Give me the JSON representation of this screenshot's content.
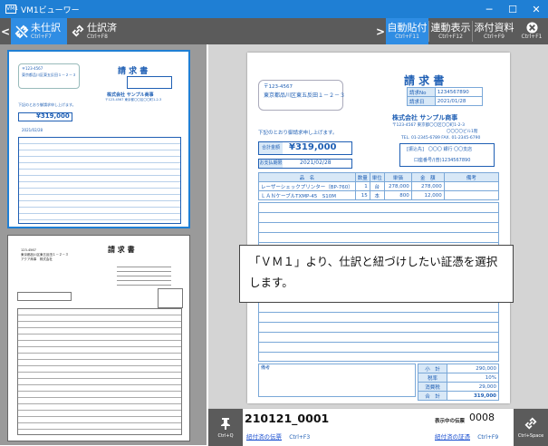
{
  "window": {
    "title": "VM1ビューワー",
    "icon_text": "VM1",
    "min": "─",
    "max": "☐",
    "close": "✕"
  },
  "toolbar": {
    "prev": "<",
    "next": ">",
    "unjournaled": {
      "label": "未仕訳",
      "shortcut": "Ctrl+F7"
    },
    "journaled": {
      "label": "仕訳済",
      "shortcut": "Ctrl+F8"
    },
    "auto_attach": {
      "label": "自動貼付",
      "shortcut": "Ctrl+F11"
    },
    "linked_view": {
      "label": "連動表示",
      "shortcut": "Ctrl+F12"
    },
    "attachments": {
      "label": "添付資料",
      "shortcut": "Ctrl+F9"
    },
    "close": {
      "shortcut": "Ctrl+F1"
    }
  },
  "invoice": {
    "postal": "〒123-4567",
    "address": "東京都品川区東五反田１－２－３",
    "title": "請 求 書",
    "no_label": "請求No",
    "no_value": "1234567890",
    "date_label": "請求日",
    "date_value": "2021/01/28",
    "company": "株式会社 サンプル商事",
    "company_addr": "〒123-4567 東京都〇〇区〇〇町1-2-3",
    "bldg": "〇〇〇〇ビル1階",
    "tel": "TEL. 01-2345-6789 FAX. 01-2345-6790",
    "message": "下記のとおり御請求申し上げます。",
    "total_label": "合計金額",
    "total_value": "¥319,000",
    "due_label": "お支払期限",
    "due_value": "2021/02/28",
    "bank": "[振込先]　〇〇〇 銀行 〇〇支店",
    "account": "口座番号/(普)1234567890",
    "headers": [
      "品　名",
      "数量",
      "単位",
      "単価",
      "金　額",
      "備考"
    ],
    "rows": [
      [
        "レーザーシェックプリンター（BP-760）",
        "1",
        "台",
        "278,000",
        "278,000",
        ""
      ],
      [
        "ＬＡＮケーブルTXMP-45　S10M",
        "15",
        "本",
        "800",
        "12,000",
        ""
      ]
    ],
    "remarks_label": "備考",
    "subtotal_label": "小　計",
    "subtotal_value": "290,000",
    "taxrate_label": "税率",
    "taxrate_value": "10%",
    "tax_label": "消費税",
    "tax_value": "29,000",
    "grand_label": "合　計",
    "grand_value": "319,000"
  },
  "thumb2": {
    "title": "請 求 書",
    "lines": [
      "123-4567",
      "東京都品川区東五反田１－２－３",
      "アクア商事　株式会社"
    ]
  },
  "callout": {
    "text": "「ＶＭ１」より、仕訳と紐づけしたい証憑を選択します。"
  },
  "bottom": {
    "pin_shortcut": "Ctrl+Q",
    "doc_id": "210121_0001",
    "linked_label": "紐付済の伝票",
    "linked_shortcut": "Ctrl+F3",
    "current_label": "表示中の伝票",
    "current_value": "0008",
    "linked_doc_label": "紐付済の証憑",
    "linked_doc_shortcut": "Ctrl+F9",
    "link_shortcut": "Ctrl+Space"
  }
}
